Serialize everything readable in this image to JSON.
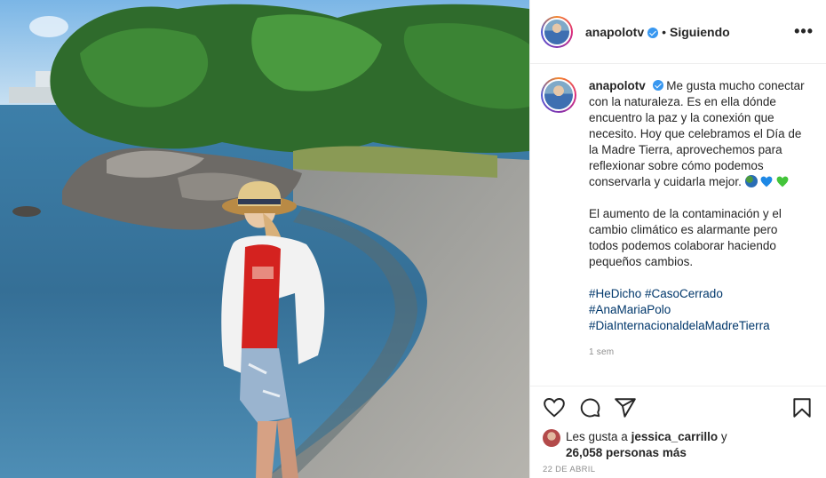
{
  "post": {
    "username": "anapolotv",
    "separator": "•",
    "follow_status": "Siguiendo",
    "more_label": "•••",
    "caption_paragraphs": [
      "Me gusta mucho conectar con la naturaleza. Es en ella dónde encuentro la paz y la conexión que necesito. Hoy que celebramos el Día de la Madre Tierra, aprovechemos para reflexionar sobre cómo podemos conservarla y cuidarla mejor.",
      "El aumento de la contaminación y el cambio climático es alarmante pero todos podemos colaborar haciendo pequeños cambios."
    ],
    "caption_emojis": [
      "globe-icon",
      "blue-heart-icon",
      "green-heart-icon"
    ],
    "hashtags": [
      "#HeDicho #CasoCerrado",
      "#AnaMariaPolo",
      "#DiaInternacionaldelaMadreTierra"
    ],
    "time_ago": "1 sem",
    "likes": {
      "prefix": "Les gusta a",
      "user": "jessica_carrillo",
      "conj": "y",
      "count": "26,058 personas más"
    },
    "date": "22 DE ABRIL"
  },
  "icons": [
    "heart-icon",
    "comment-icon",
    "share-icon",
    "bookmark-icon",
    "verified-badge-icon"
  ],
  "colors": {
    "link": "#00376b",
    "verified": "#3897f0",
    "blue_heart": "#1e88e5",
    "green_heart": "#43c43a"
  }
}
